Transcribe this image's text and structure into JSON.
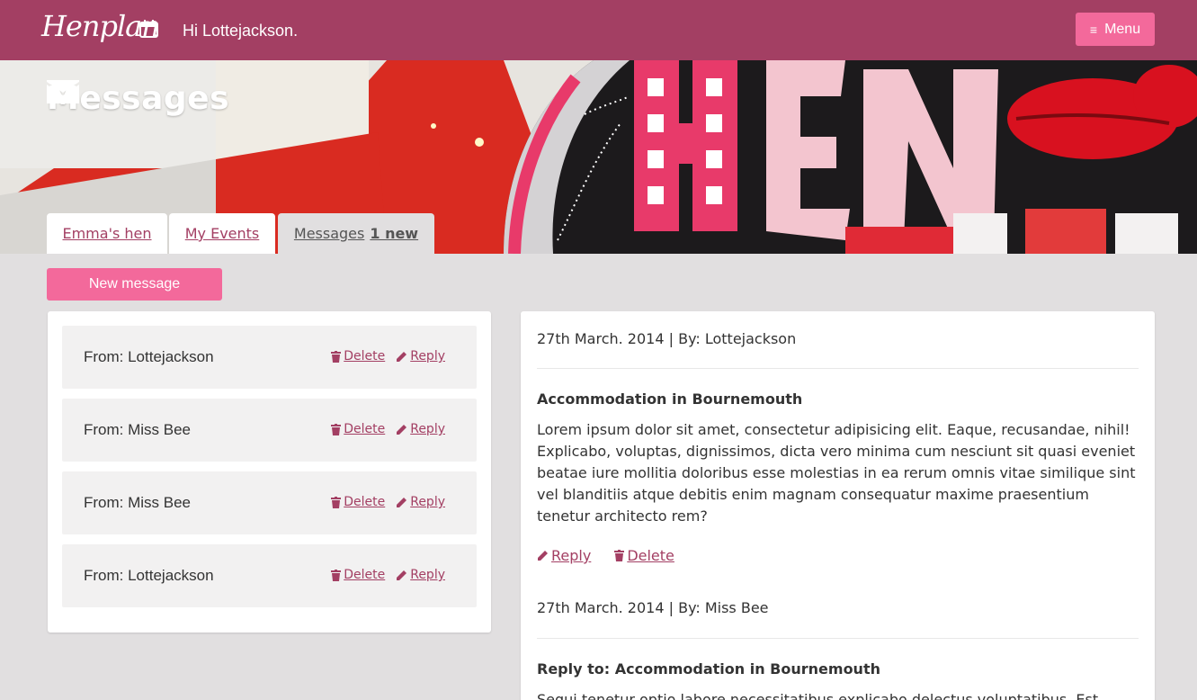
{
  "header": {
    "logo_text": "Henplan",
    "greeting": "Hi Lottejackson.",
    "menu_label": "Menu"
  },
  "hero": {
    "title": "Messages"
  },
  "tabs": [
    {
      "label": "Emma's hen"
    },
    {
      "label": "My Events"
    },
    {
      "label": "Messages",
      "badge": "1 new"
    }
  ],
  "new_message_label": "New message",
  "messages_list": [
    {
      "from": "From: Lottejackson",
      "delete_label": "Delete",
      "reply_label": "Reply"
    },
    {
      "from": "From: Miss Bee",
      "delete_label": "Delete",
      "reply_label": "Reply"
    },
    {
      "from": "From: Miss Bee",
      "delete_label": "Delete",
      "reply_label": "Reply"
    },
    {
      "from": "From: Lottejackson",
      "delete_label": "Delete",
      "reply_label": "Reply"
    }
  ],
  "thread": [
    {
      "meta": "27th March. 2014 | By: Lottejackson",
      "subject": "Accommodation in Bournemouth",
      "body": "Lorem ipsum dolor sit amet, consectetur adipisicing elit. Eaque, recusandae, nihil! Explicabo, voluptas, dignissimos, dicta vero minima cum nesciunt sit quasi eveniet beatae iure mollitia doloribus esse molestias in ea rerum omnis vitae similique sint vel blanditiis atque debitis enim magnam consequatur maxime praesentium tenetur architecto rem?",
      "reply_label": "Reply",
      "delete_label": "Delete"
    },
    {
      "meta": "27th March. 2014 | By: Miss Bee",
      "subject": "Reply to: Accommodation in Bournemouth",
      "body": "Sequi tenetur optio labore necessitatibus explicabo delectus voluptatibus. Est"
    }
  ],
  "colors": {
    "brand": "#a33f63",
    "accent_pink": "#f3699b",
    "page_bg": "#e1dfe0"
  }
}
